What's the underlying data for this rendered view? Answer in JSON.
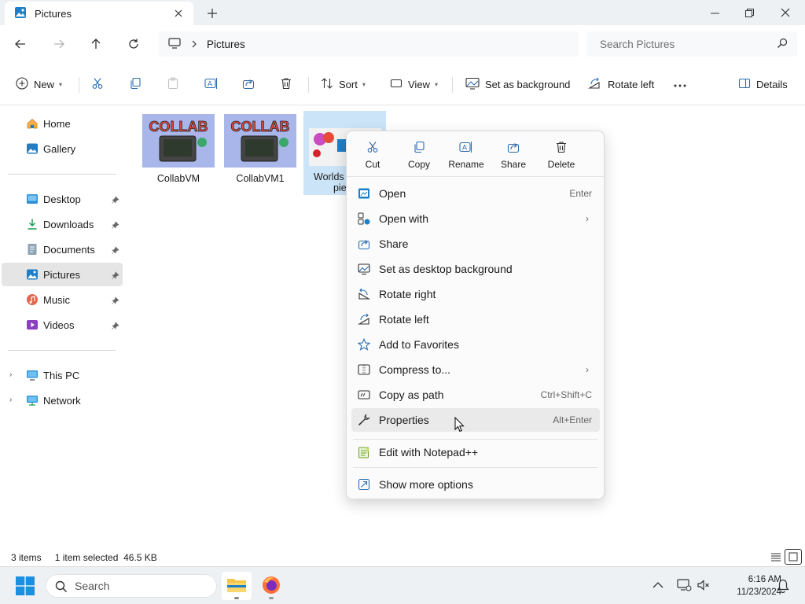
{
  "window": {
    "tab_title": "Pictures",
    "minimize_icon": "minimize-icon",
    "maximize_icon": "maximize-icon",
    "close_icon": "close-icon"
  },
  "address": {
    "crumb": "Pictures",
    "search_placeholder": "Search Pictures"
  },
  "toolbar": {
    "new_label": "New",
    "sort_label": "Sort",
    "view_label": "View",
    "set_bg_label": "Set as background",
    "rotate_left_label": "Rotate left",
    "details_label": "Details"
  },
  "sidebar": {
    "items": [
      {
        "label": "Home",
        "icon": "home-icon"
      },
      {
        "label": "Gallery",
        "icon": "gallery-icon"
      },
      {
        "label": "Desktop",
        "icon": "desktop-icon"
      },
      {
        "label": "Downloads",
        "icon": "downloads-icon"
      },
      {
        "label": "Documents",
        "icon": "documents-icon"
      },
      {
        "label": "Pictures",
        "icon": "pictures-icon"
      },
      {
        "label": "Music",
        "icon": "music-icon"
      },
      {
        "label": "Videos",
        "icon": "videos-icon"
      },
      {
        "label": "This PC",
        "icon": "this-pc-icon"
      },
      {
        "label": "Network",
        "icon": "network-icon"
      }
    ]
  },
  "files": [
    {
      "name": "CollabVM"
    },
    {
      "name": "CollabVM1"
    },
    {
      "name_line1": "Worlds",
      "name_line2": "pie"
    }
  ],
  "thumb_text": "COLLAB",
  "status": {
    "count": "3 items",
    "selection": "1 item selected  46.5 KB"
  },
  "context_menu": {
    "quick_actions": [
      {
        "label": "Cut"
      },
      {
        "label": "Copy"
      },
      {
        "label": "Rename"
      },
      {
        "label": "Share"
      },
      {
        "label": "Delete"
      }
    ],
    "items": [
      {
        "label": "Open",
        "accel": "Enter"
      },
      {
        "label": "Open with"
      },
      {
        "label": "Share"
      },
      {
        "label": "Set as desktop background"
      },
      {
        "label": "Rotate right"
      },
      {
        "label": "Rotate left"
      },
      {
        "label": "Add to Favorites"
      },
      {
        "label": "Compress to..."
      },
      {
        "label": "Copy as path",
        "accel": "Ctrl+Shift+C"
      },
      {
        "label": "Properties",
        "accel": "Alt+Enter"
      },
      {
        "label": "Edit with Notepad++"
      },
      {
        "label": "Show more options"
      }
    ]
  },
  "taskbar": {
    "search_label": "Search",
    "time": "6:16 AM",
    "date": "11/23/2024"
  },
  "colors": {
    "accent": "#0067c0",
    "selection": "#cce4f7",
    "folder": "#f6c54a"
  }
}
